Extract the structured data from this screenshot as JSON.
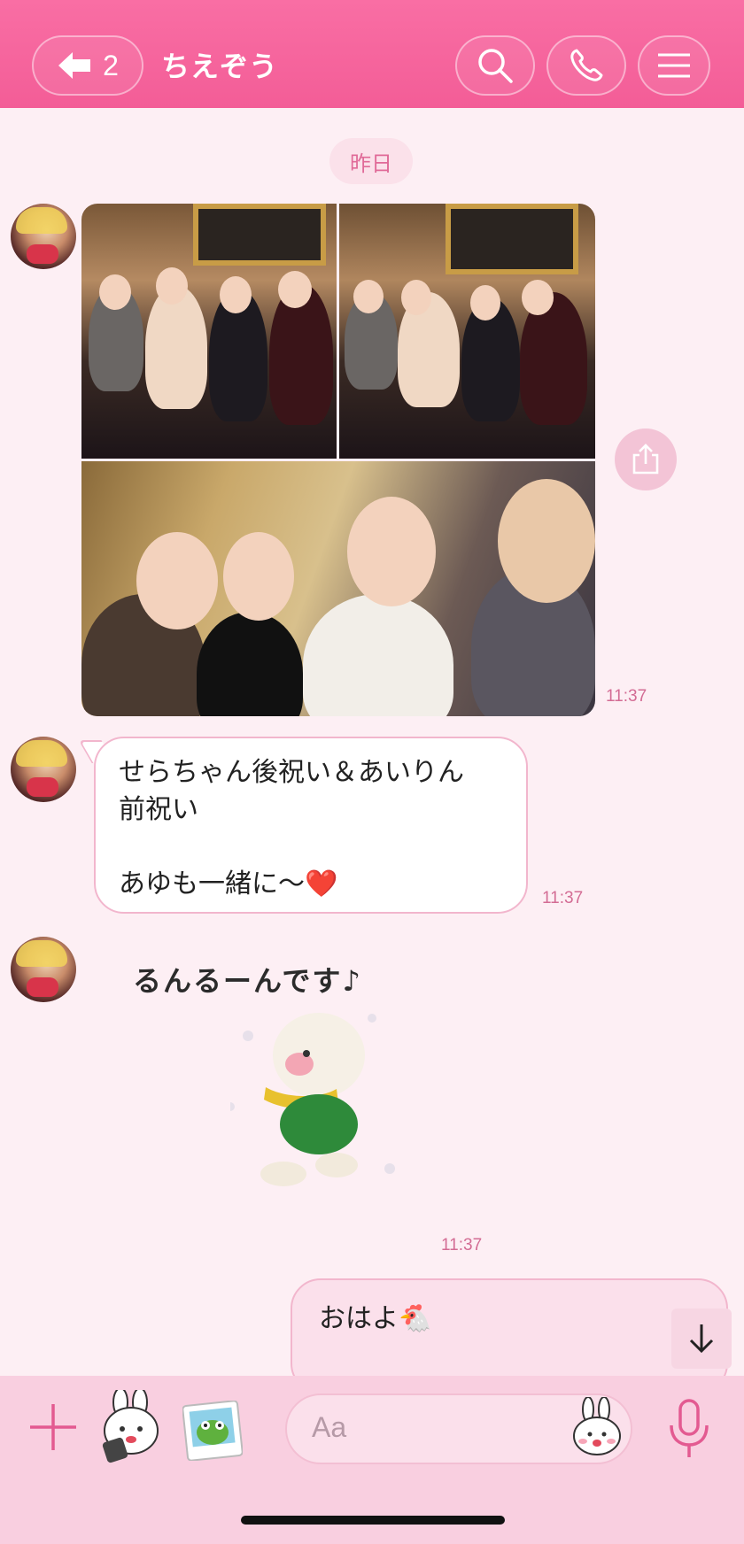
{
  "header": {
    "back_count": "2",
    "title": "ちえぞう",
    "icons": [
      "back-arrow-icon",
      "search-icon",
      "phone-icon",
      "menu-icon"
    ]
  },
  "chat": {
    "date_label": "昨日",
    "messages": [
      {
        "type": "photos",
        "count": 3,
        "time": "11:37"
      },
      {
        "type": "text",
        "lines": [
          "せらちゃん後祝い＆あいりん",
          "前祝い",
          "",
          "あゆも一緒に〜❤️"
        ],
        "time": "11:37"
      },
      {
        "type": "sticker",
        "sticker_text": "るんるーんです♪",
        "time": "11:37"
      },
      {
        "type": "text-self",
        "text": "おはよ🐔"
      }
    ]
  },
  "composer": {
    "placeholder": "Aa",
    "icons": [
      "plus-icon",
      "sticker-icon",
      "photo-icon",
      "emoji-icon",
      "mic-icon"
    ]
  },
  "colors": {
    "header": "#f35d97",
    "background": "#fdeff4",
    "accent": "#e06a98",
    "bottom_bar": "#f9cfe0"
  }
}
